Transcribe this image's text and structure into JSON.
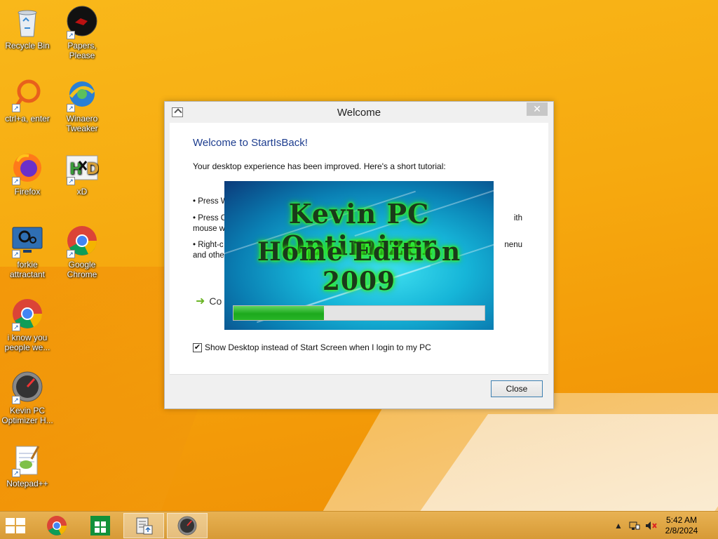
{
  "desktop": {
    "icons": [
      {
        "label": "Recycle Bin",
        "icon": "recycle-bin-icon"
      },
      {
        "label": "Papers, Please",
        "icon": "papers-please-icon"
      },
      {
        "label": "ctrl+a, enter",
        "icon": "ring-app-icon"
      },
      {
        "label": "Winaero Tweaker",
        "icon": "winaero-tweaker-icon"
      },
      {
        "label": "Firefox",
        "icon": "firefox-icon"
      },
      {
        "label": "xD",
        "icon": "hxd-icon"
      },
      {
        "label": "forkie attractant",
        "icon": "settings-monitor-icon"
      },
      {
        "label": "Google Chrome",
        "icon": "chrome-icon"
      },
      {
        "label": "i know you people we...",
        "icon": "chrome-icon"
      },
      {
        "label": "Kevin PC Optimizer H...",
        "icon": "speedometer-icon"
      },
      {
        "label": "Notepad++",
        "icon": "notepad-plus-icon"
      }
    ]
  },
  "dialog": {
    "title": "Welcome",
    "close_glyph": "✕",
    "heading": "Welcome to StartIsBack!",
    "intro": "Your desktop experience has been improved. Here's a short tutorial:",
    "bullets": [
      {
        "left": "• Press W",
        "right": ""
      },
      {
        "left": "• Press C",
        "right": "ith",
        "left2": "mouse w"
      },
      {
        "left": "• Right-c",
        "right": "nenu",
        "left2": "and othe"
      }
    ],
    "continue_text": "Co",
    "checkbox_label": "Show Desktop instead of Start Screen when I login to my PC",
    "checkbox_checked": "✔",
    "close_button": "Close"
  },
  "splash": {
    "title_line1": "Kevin PC Optimizer",
    "title_line2": "Home Edition 2009",
    "progress": 0.36
  },
  "taskbar": {
    "clock_time": "5:42 AM",
    "clock_date": "2/8/2024",
    "tray_arrow": "▲",
    "accent": "#d79a36"
  }
}
